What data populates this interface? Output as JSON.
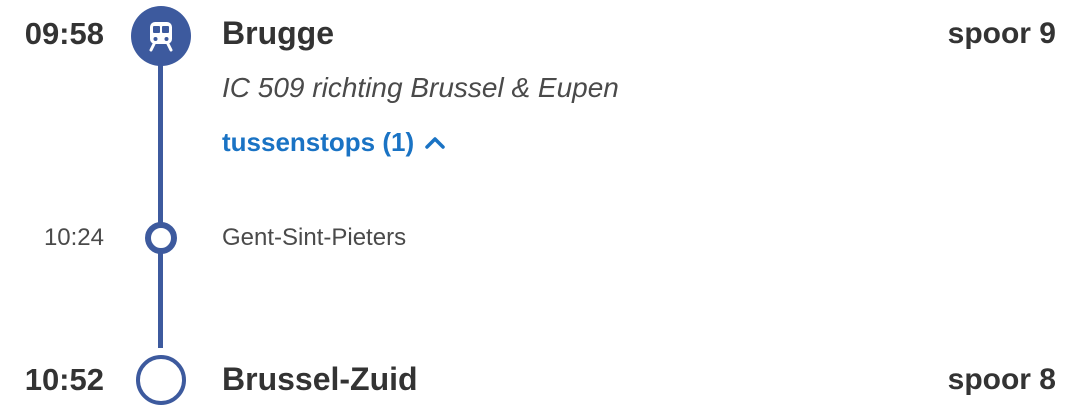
{
  "colors": {
    "timeline": "#3d5a9e",
    "link": "#1a73c4",
    "text_primary": "#333333",
    "text_secondary": "#4a4a4a"
  },
  "journey": {
    "departure": {
      "time": "09:58",
      "station": "Brugge",
      "platform": "spoor 9",
      "icon": "train-icon"
    },
    "train": {
      "line": "IC 509 richting Brussel & Eupen"
    },
    "intermediate_toggle": {
      "label": "tussenstops (1)",
      "icon": "chevron-up-icon",
      "expanded": true
    },
    "intermediate_stops": [
      {
        "time": "10:24",
        "station": "Gent-Sint-Pieters"
      }
    ],
    "arrival": {
      "time": "10:52",
      "station": "Brussel-Zuid",
      "platform": "spoor 8"
    }
  }
}
